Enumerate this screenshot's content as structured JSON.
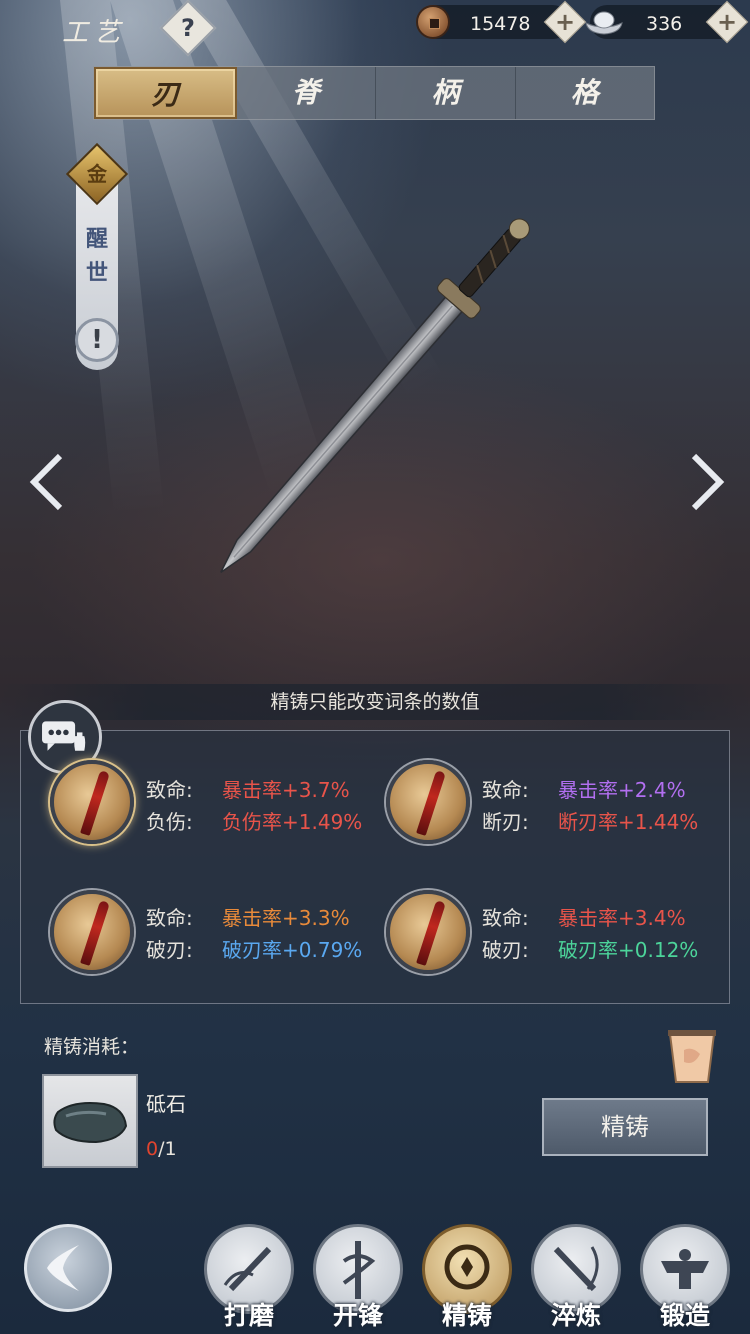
{
  "header": {
    "title": "工艺",
    "help_icon": "question-icon",
    "currency": {
      "copper_value": "15478",
      "silver_value": "336",
      "copper_icon": "copper-coin-icon",
      "silver_icon": "silver-ingot-icon"
    }
  },
  "tabs": [
    {
      "label": "刃",
      "active": true
    },
    {
      "label": "脊",
      "active": false
    },
    {
      "label": "柄",
      "active": false
    },
    {
      "label": "格",
      "active": false
    }
  ],
  "side_badge": {
    "grade": "金",
    "name_top": "醒",
    "name_bottom": "世",
    "info": "!"
  },
  "notice": "精铸只能改变词条的数值",
  "stats": [
    {
      "line1_label": "致命:",
      "line1_value": "暴击率+3.7%",
      "line1_color": "#e8544a",
      "line2_label": "负伤:",
      "line2_value": "负伤率+1.49%",
      "line2_color": "#e8544a"
    },
    {
      "line1_label": "致命:",
      "line1_value": "暴击率+2.4%",
      "line1_color": "#b26ff0",
      "line2_label": "断刃:",
      "line2_value": "断刃率+1.44%",
      "line2_color": "#e8544a"
    },
    {
      "line1_label": "致命:",
      "line1_value": "暴击率+3.3%",
      "line1_color": "#e88a3a",
      "line2_label": "破刃:",
      "line2_value": "破刃率+0.79%",
      "line2_color": "#5aa8f0"
    },
    {
      "line1_label": "致命:",
      "line1_value": "暴击率+3.4%",
      "line1_color": "#e8544a",
      "line2_label": "破刃:",
      "line2_value": "破刃率+0.12%",
      "line2_color": "#4cd49a"
    }
  ],
  "cost": {
    "label": "精铸消耗：",
    "item_name": "砥石",
    "have": "0",
    "need": "/1"
  },
  "refine_button": "精铸",
  "nav": [
    {
      "label": "打磨",
      "icon": "grind-icon",
      "active": false
    },
    {
      "label": "开锋",
      "icon": "sharpen-icon",
      "active": false
    },
    {
      "label": "精铸",
      "icon": "refine-icon",
      "active": true
    },
    {
      "label": "淬炼",
      "icon": "temper-icon",
      "active": false
    },
    {
      "label": "锻造",
      "icon": "forge-icon",
      "active": false
    }
  ]
}
